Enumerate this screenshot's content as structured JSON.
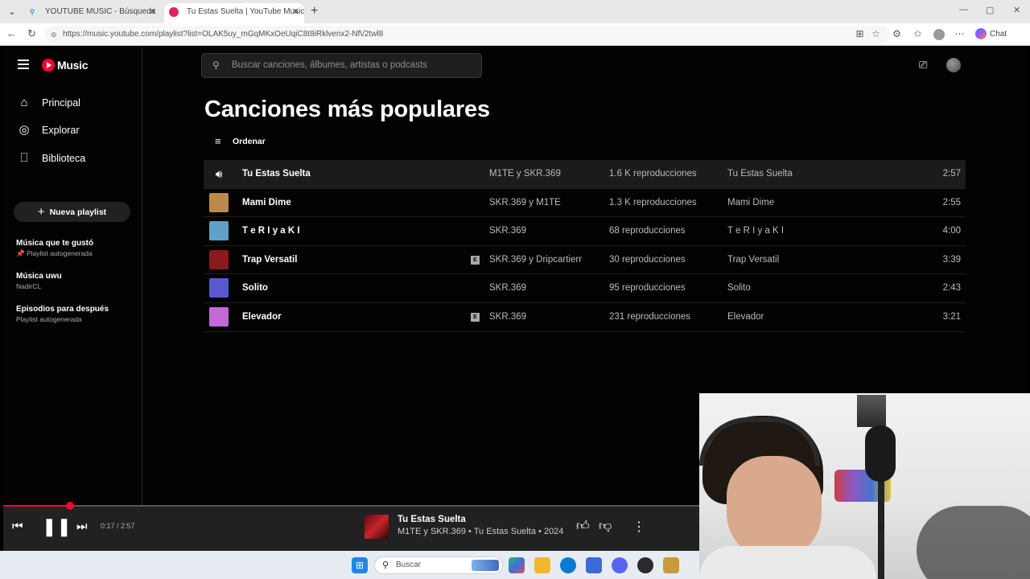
{
  "browser": {
    "tabs": [
      {
        "title": "YOUTUBE MUSIC - Búsqueda",
        "active": false
      },
      {
        "title": "Tu Estas Suelta | YouTube Music",
        "active": true
      }
    ],
    "url": "https://music.youtube.com/playlist?list=OLAK5uy_mGqMKxOeUqiC8t8iRklvenx2-Nf\\/2twl8",
    "chat_label": "Chat"
  },
  "app": {
    "logo_text": "Music",
    "search_placeholder": "Buscar canciones, álbumes, artistas o podcasts",
    "nav": [
      {
        "label": "Principal",
        "icon": "home-icon"
      },
      {
        "label": "Explorar",
        "icon": "compass-icon"
      },
      {
        "label": "Biblioteca",
        "icon": "bookmark-icon"
      }
    ],
    "new_playlist_label": "Nueva playlist",
    "playlists": [
      {
        "name": "Música que te gustó",
        "subtitle": "📌 Playlist autogenerada"
      },
      {
        "name": "Música uwu",
        "subtitle": "NadirCL"
      },
      {
        "name": "Episodios para después",
        "subtitle": "Playlist autogenerada"
      }
    ]
  },
  "main": {
    "title": "Canciones más populares",
    "sort_label": "Ordenar",
    "tracks": [
      {
        "name": "Tu Estas Suelta",
        "explicit": false,
        "artist": "M1TE y SKR.369",
        "plays": "1.6 K reproducciones",
        "album": "Tu Estas Suelta",
        "duration": "2:57",
        "playing": true,
        "thumb": "#6b4a2a"
      },
      {
        "name": "Mami Dime",
        "explicit": false,
        "artist": "SKR.369 y M1TE",
        "plays": "1.3 K reproducciones",
        "album": "Mami Dime",
        "duration": "2:55",
        "playing": false,
        "thumb": "#b88a4c"
      },
      {
        "name": "T e R I y a K I",
        "explicit": false,
        "artist": "SKR.369",
        "plays": "68 reproducciones",
        "album": "T e R I y a K I",
        "duration": "4:00",
        "playing": false,
        "thumb": "#5fa0c8"
      },
      {
        "name": "Trap Versatil",
        "explicit": true,
        "artist": "SKR.369 y Dripcartierr",
        "plays": "30 reproducciones",
        "album": "Trap Versatil",
        "duration": "3:39",
        "playing": false,
        "thumb": "#8c1a1a"
      },
      {
        "name": "Solito",
        "explicit": false,
        "artist": "SKR.369",
        "plays": "95 reproducciones",
        "album": "Solito",
        "duration": "2:43",
        "playing": false,
        "thumb": "#5a5ad0"
      },
      {
        "name": "Elevador",
        "explicit": true,
        "artist": "SKR.369",
        "plays": "231 reproducciones",
        "album": "Elevador",
        "duration": "3:21",
        "playing": false,
        "thumb": "#c06ad8"
      }
    ],
    "explicit_badge": "E"
  },
  "player": {
    "time": "0:17 / 2:57",
    "progress_fraction": 0.096,
    "title": "Tu Estas Suelta",
    "subtitle": "M1TE y SKR.369 • Tu Estas Suelta • 2024"
  },
  "taskbar": {
    "search_placeholder": "Buscar"
  }
}
